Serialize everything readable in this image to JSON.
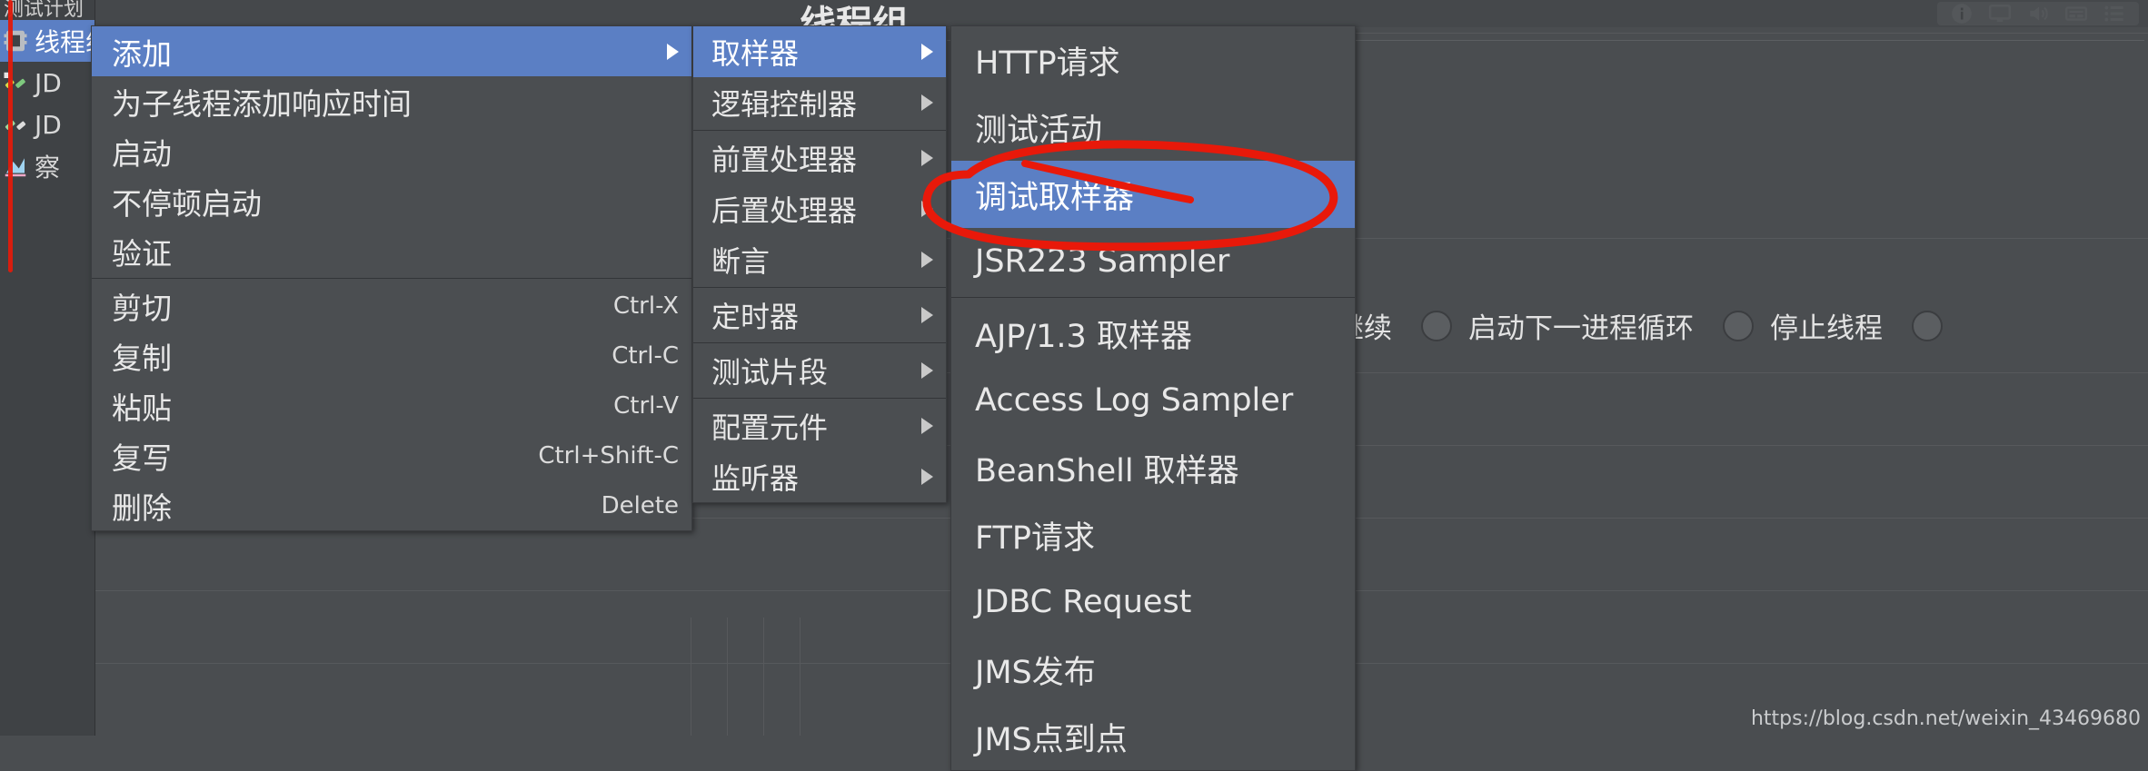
{
  "window": {
    "background_color": "#4a4d50",
    "accent_color": "#5b7fc4",
    "ink_color": "#e01b0c"
  },
  "tray": {
    "icons": [
      "info-icon",
      "display-icon",
      "volume-icon",
      "keyboard-icon",
      "list-icon"
    ]
  },
  "tree": {
    "header": "测试计划",
    "items": [
      {
        "label": "线程组",
        "icon": "thread-group-icon",
        "selected": true
      },
      {
        "label": "JD",
        "icon": "jdbc-connection-icon",
        "selected": false
      },
      {
        "label": "JD",
        "icon": "jdbc-request-icon",
        "selected": false
      },
      {
        "label": "察",
        "icon": "view-results-tree-icon",
        "selected": false
      }
    ]
  },
  "center": {
    "title": "线程组"
  },
  "form": {
    "action_label": "继续",
    "radios": [
      {
        "label": "启动下一进程循环",
        "selected": false
      },
      {
        "label": "停止线程",
        "selected": false
      },
      {
        "label": "",
        "selected": false
      }
    ]
  },
  "context_menu": {
    "name": "thread-group-context-menu",
    "items": [
      {
        "label": "添加",
        "accel": "",
        "submenu": true,
        "highlight": true
      },
      {
        "label": "为子线程添加响应时间",
        "accel": "",
        "submenu": false,
        "highlight": false
      },
      {
        "label": "启动",
        "accel": "",
        "submenu": false,
        "highlight": false
      },
      {
        "label": "不停顿启动",
        "accel": "",
        "submenu": false,
        "highlight": false
      },
      {
        "label": "验证",
        "accel": "",
        "submenu": false,
        "highlight": false
      },
      {
        "separator": true
      },
      {
        "label": "剪切",
        "accel": "Ctrl-X",
        "submenu": false,
        "highlight": false
      },
      {
        "label": "复制",
        "accel": "Ctrl-C",
        "submenu": false,
        "highlight": false
      },
      {
        "label": "粘贴",
        "accel": "Ctrl-V",
        "submenu": false,
        "highlight": false
      },
      {
        "label": "复写",
        "accel": "Ctrl+Shift-C",
        "submenu": false,
        "highlight": false
      },
      {
        "label": "删除",
        "accel": "Delete",
        "submenu": false,
        "highlight": false
      }
    ]
  },
  "add_menu": {
    "name": "add-submenu",
    "items": [
      {
        "label": "取样器",
        "submenu": true,
        "highlight": true
      },
      {
        "label": "逻辑控制器",
        "submenu": true,
        "highlight": false
      },
      {
        "separator": true
      },
      {
        "label": "前置处理器",
        "submenu": true,
        "highlight": false
      },
      {
        "label": "后置处理器",
        "submenu": true,
        "highlight": false
      },
      {
        "label": "断言",
        "submenu": true,
        "highlight": false
      },
      {
        "separator": true
      },
      {
        "label": "定时器",
        "submenu": true,
        "highlight": false
      },
      {
        "separator": true
      },
      {
        "label": "测试片段",
        "submenu": true,
        "highlight": false
      },
      {
        "separator": true
      },
      {
        "label": "配置元件",
        "submenu": true,
        "highlight": false
      },
      {
        "label": "监听器",
        "submenu": true,
        "highlight": false
      }
    ]
  },
  "sampler_menu": {
    "name": "sampler-submenu",
    "items": [
      {
        "label": "HTTP请求",
        "highlight": false
      },
      {
        "label": "测试活动",
        "highlight": false
      },
      {
        "label": "调试取样器",
        "highlight": true
      },
      {
        "label": "JSR223 Sampler",
        "highlight": false
      },
      {
        "separator": true
      },
      {
        "label": "AJP/1.3 取样器",
        "highlight": false
      },
      {
        "label": "Access Log Sampler",
        "highlight": false
      },
      {
        "label": "BeanShell 取样器",
        "highlight": false
      },
      {
        "label": "FTP请求",
        "highlight": false
      },
      {
        "label": "JDBC Request",
        "highlight": false
      },
      {
        "label": "JMS发布",
        "highlight": false
      },
      {
        "label": "JMS点到点",
        "highlight": false
      }
    ]
  },
  "annotation": {
    "target_label": "调试取样器",
    "shape": "hand-drawn-red-ellipse"
  },
  "watermark": {
    "text": "https://blog.csdn.net/weixin_43469680"
  }
}
